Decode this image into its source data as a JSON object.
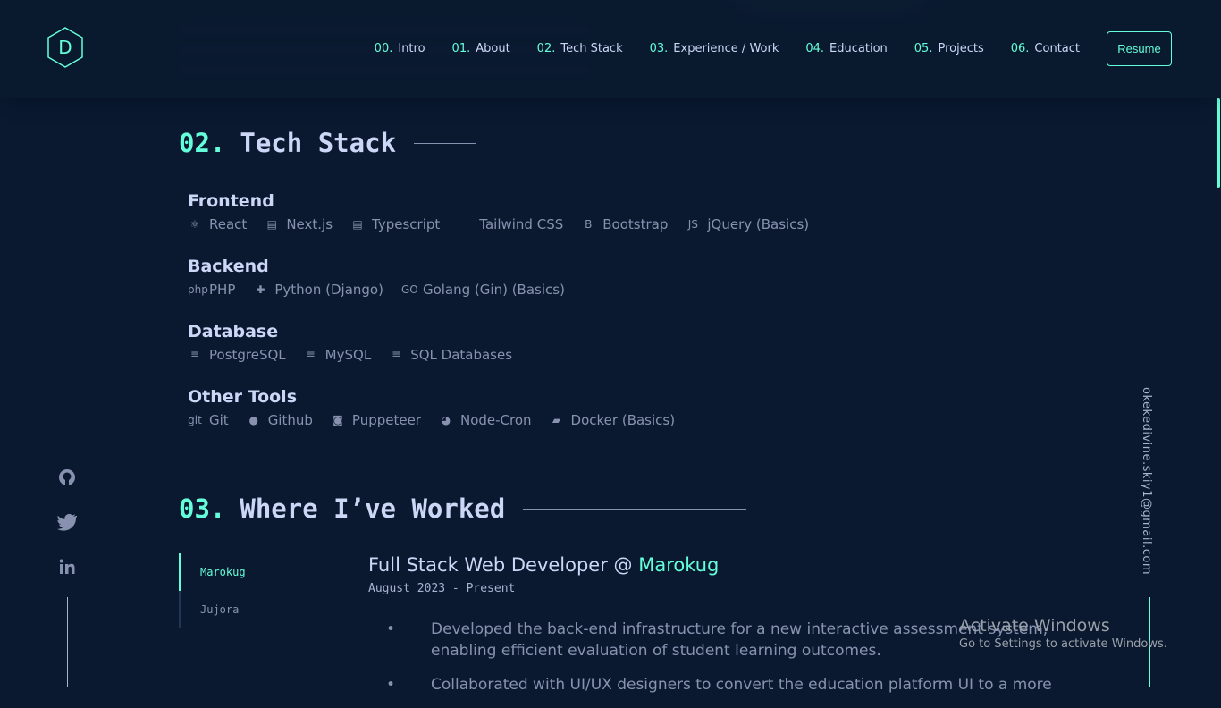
{
  "header": {
    "logo_letter": "D",
    "nav": [
      {
        "num": "00.",
        "label": "Intro"
      },
      {
        "num": "01.",
        "label": "About"
      },
      {
        "num": "02.",
        "label": "Tech Stack"
      },
      {
        "num": "03.",
        "label": "Experience / Work"
      },
      {
        "num": "04.",
        "label": "Education"
      },
      {
        "num": "05.",
        "label": "Projects"
      },
      {
        "num": "06.",
        "label": "Contact"
      }
    ],
    "resume": "Resume"
  },
  "tech": {
    "num": "02.",
    "title": "Tech Stack",
    "categories": [
      {
        "name": "Frontend",
        "items": [
          {
            "icon": "react-icon",
            "g": "⚛",
            "label": "React"
          },
          {
            "icon": "file-icon",
            "g": "▤",
            "label": "Next.js"
          },
          {
            "icon": "file-code-icon",
            "g": "▤",
            "label": "Typescript"
          },
          {
            "icon": "code-icon",
            "g": "</>",
            "label": "Tailwind CSS"
          },
          {
            "icon": "bootstrap-icon",
            "g": "B",
            "label": "Bootstrap"
          },
          {
            "icon": "js-icon",
            "g": "JS",
            "label": "jQuery (Basics)"
          }
        ]
      },
      {
        "name": "Backend",
        "items": [
          {
            "icon": "php-icon",
            "g": "php",
            "label": "PHP"
          },
          {
            "icon": "python-icon",
            "g": "✚",
            "label": "Python (Django)"
          },
          {
            "icon": "go-icon",
            "g": "GO",
            "label": "Golang (Gin) (Basics)"
          }
        ]
      },
      {
        "name": "Database",
        "items": [
          {
            "icon": "database-icon",
            "g": "≣",
            "label": "PostgreSQL"
          },
          {
            "icon": "database-icon",
            "g": "≣",
            "label": "MySQL"
          },
          {
            "icon": "database-icon",
            "g": "≣",
            "label": "SQL Databases"
          }
        ]
      },
      {
        "name": "Other Tools",
        "items": [
          {
            "icon": "git-icon",
            "g": "git",
            "label": "Git"
          },
          {
            "icon": "github-icon",
            "g": "●",
            "label": "Github"
          },
          {
            "icon": "robot-icon",
            "g": "◙",
            "label": "Puppeteer"
          },
          {
            "icon": "clock-icon",
            "g": "◕",
            "label": "Node-Cron"
          },
          {
            "icon": "docker-icon",
            "g": "▰",
            "label": "Docker (Basics)"
          }
        ]
      }
    ]
  },
  "work": {
    "num": "03.",
    "title": "Where I’ve Worked",
    "tabs": [
      "Marokug",
      "Jujora"
    ],
    "job": {
      "role": "Full Stack Web Developer @ ",
      "company": "Marokug",
      "date": "August 2023 - Present",
      "bullets": [
        "Developed the back-end infrastructure for a new interactive assessment system, enabling efficient evaluation of student learning outcomes.",
        "Collaborated with UI/UX designers to convert the education platform UI to a more"
      ]
    }
  },
  "email": "okekedivine.skiy1@gmail.com",
  "windows": {
    "line1": "Activate Windows",
    "line2": "Go to Settings to activate Windows."
  },
  "colors": {
    "bg": "#0a192f",
    "accent": "#64ffda",
    "text": "#ccd6f6",
    "muted": "#8892b0"
  }
}
